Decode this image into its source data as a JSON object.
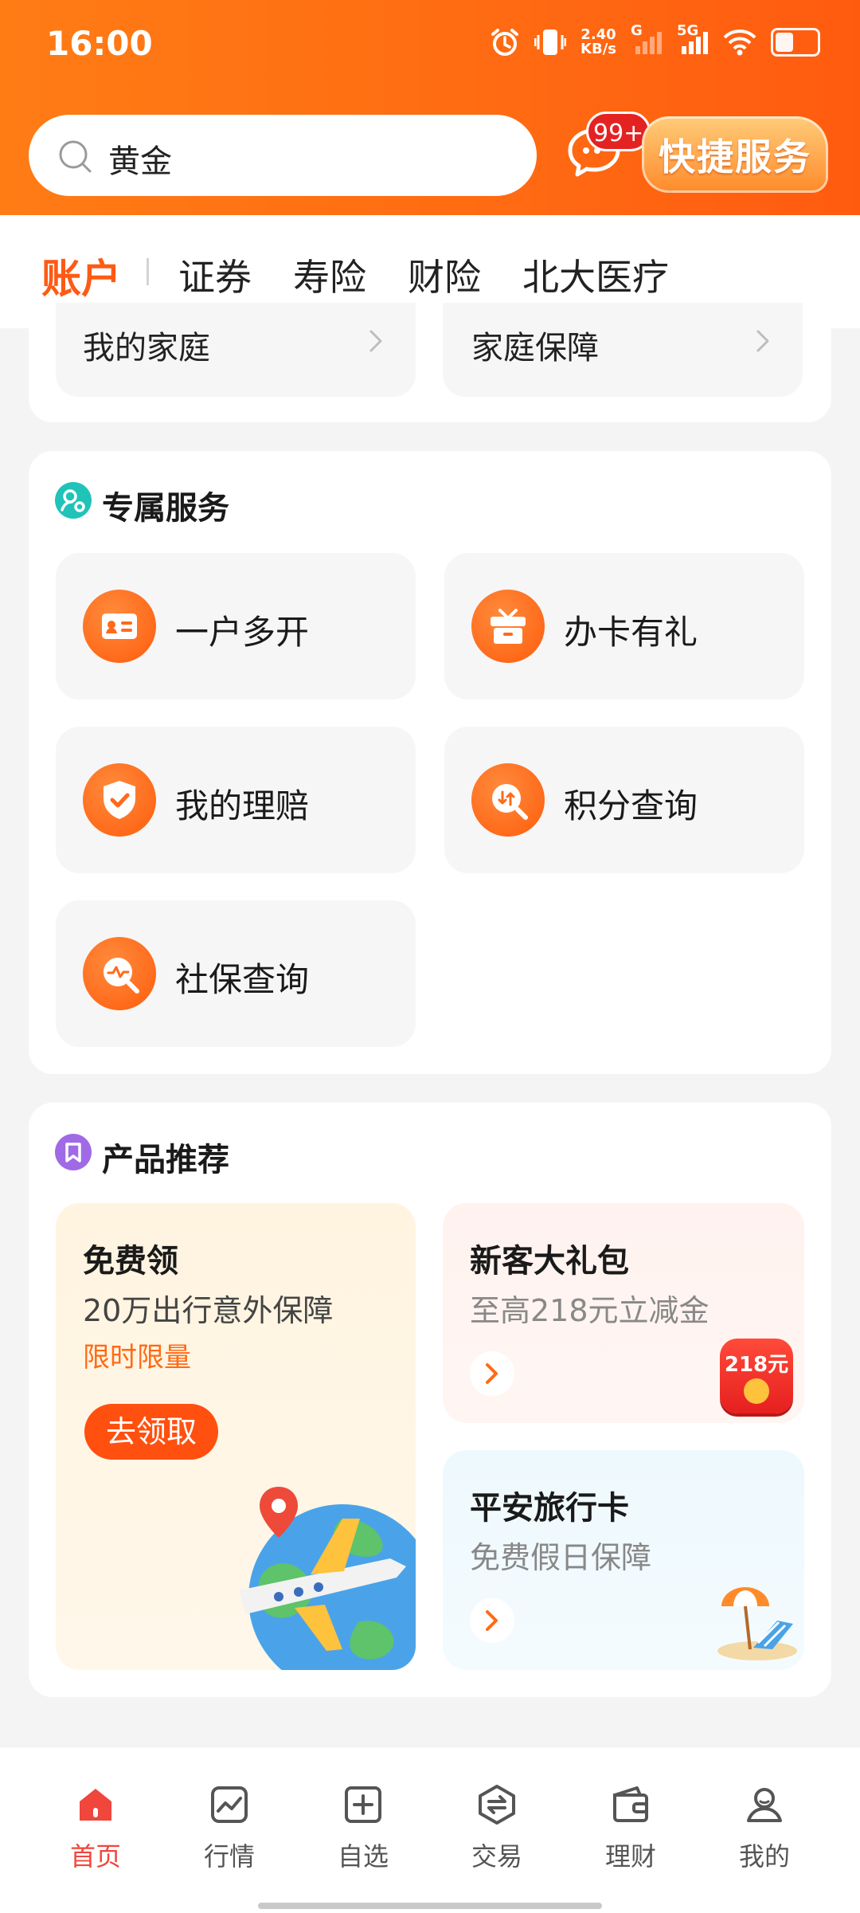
{
  "status": {
    "time": "16:00",
    "net_speed_top": "2.40",
    "net_speed_bottom": "KB/s",
    "sig1": "G",
    "sig2": "5G"
  },
  "search": {
    "query": "黄金"
  },
  "header": {
    "msg_badge": "99+",
    "quick_service": "快捷服务"
  },
  "tabs": [
    {
      "label": "账户",
      "active": true
    },
    {
      "label": "证券"
    },
    {
      "label": "寿险"
    },
    {
      "label": "财险"
    },
    {
      "label": "北大医疗"
    }
  ],
  "family": {
    "my_family": "我的家庭",
    "family_protection": "家庭保障"
  },
  "exclusive": {
    "title": "专属服务",
    "items": [
      {
        "label": "一户多开",
        "icon": "id-card-icon"
      },
      {
        "label": "办卡有礼",
        "icon": "gift-box-icon"
      },
      {
        "label": "我的理赔",
        "icon": "shield-check-icon"
      },
      {
        "label": "积分查询",
        "icon": "points-search-icon"
      },
      {
        "label": "社保查询",
        "icon": "pulse-search-icon"
      }
    ]
  },
  "products": {
    "title": "产品推荐",
    "free": {
      "title": "免费领",
      "subtitle": "20万出行意外保障",
      "tag": "限时限量",
      "button": "去领取"
    },
    "newuser": {
      "title": "新客大礼包",
      "subtitle": "至高218元立减金",
      "badge": "218元"
    },
    "travel": {
      "title": "平安旅行卡",
      "subtitle": "免费假日保障"
    }
  },
  "nav": [
    {
      "label": "首页",
      "icon": "home-icon",
      "active": true
    },
    {
      "label": "行情",
      "icon": "market-chart-icon"
    },
    {
      "label": "自选",
      "icon": "add-watchlist-icon"
    },
    {
      "label": "交易",
      "icon": "trade-exchange-icon"
    },
    {
      "label": "理财",
      "icon": "wallet-icon"
    },
    {
      "label": "我的",
      "icon": "profile-icon"
    }
  ],
  "colors": {
    "brand_orange": "#ff6a12",
    "active_tab": "#ff5a14",
    "nav_active": "#f0463c"
  }
}
